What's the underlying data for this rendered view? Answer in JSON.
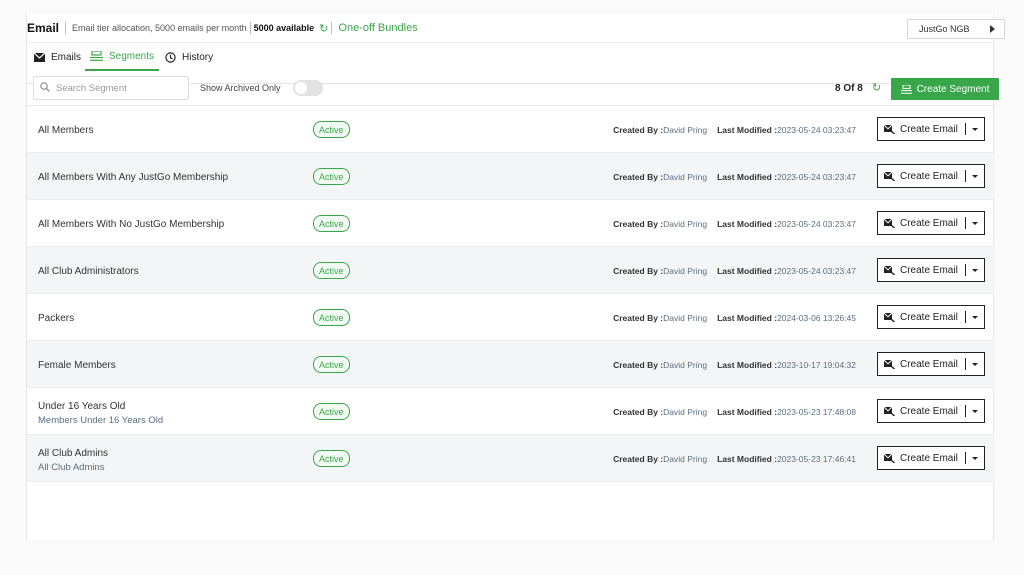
{
  "header": {
    "title": "Email",
    "allocation": "Email tier allocation, 5000 emails per month",
    "available": "5000 available",
    "bundles": "One-off Bundles",
    "org": "JustGo NGB"
  },
  "tabs": [
    {
      "label": "Emails",
      "active": false
    },
    {
      "label": "Segments",
      "active": true
    },
    {
      "label": "History",
      "active": false
    }
  ],
  "toolbar": {
    "search_placeholder": "Search Segment",
    "archived_label": "Show Archived Only",
    "archived_on": false,
    "count": "8 Of 8",
    "create_segment": "Create Segment"
  },
  "labels": {
    "created_by": "Created By :",
    "last_modified": "Last Modified :",
    "create_email": "Create Email"
  },
  "colors": {
    "accent": "#3aa64a",
    "row_alt": "#f4f5f7",
    "muted": "#5a6f80"
  },
  "segments": [
    {
      "name": "All Members",
      "sub": "",
      "status": "Active",
      "created_by": "David Pring",
      "modified": "2023-05-24 03:23:47"
    },
    {
      "name": "All Members With Any JustGo Membership",
      "sub": "",
      "status": "Active",
      "created_by": "David Pring",
      "modified": "2023-05-24 03:23:47"
    },
    {
      "name": "All Members With No JustGo Membership",
      "sub": "",
      "status": "Active",
      "created_by": "David Pring",
      "modified": "2023-05-24 03:23:47"
    },
    {
      "name": "All Club Administrators",
      "sub": "",
      "status": "Active",
      "created_by": "David Pring",
      "modified": "2023-05-24 03:23:47"
    },
    {
      "name": "Packers",
      "sub": "",
      "status": "Active",
      "created_by": "David Pring",
      "modified": "2024-03-06 13:26:45"
    },
    {
      "name": "Female Members",
      "sub": "",
      "status": "Active",
      "created_by": "David Pring",
      "modified": "2023-10-17 19:04:32"
    },
    {
      "name": "Under 16 Years Old",
      "sub": "Members Under 16 Years Old",
      "status": "Active",
      "created_by": "David Pring",
      "modified": "2023-05-23 17:48:08"
    },
    {
      "name": "All Club Admins",
      "sub": "All Club Admins",
      "status": "Active",
      "created_by": "David Pring",
      "modified": "2023-05-23 17:46:41"
    }
  ]
}
